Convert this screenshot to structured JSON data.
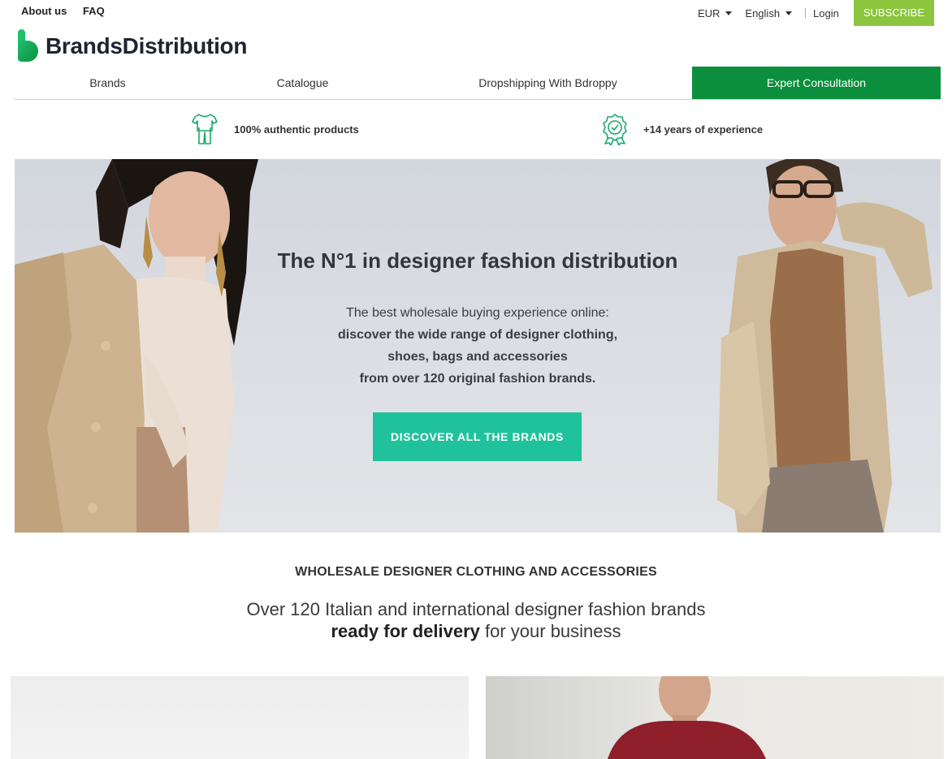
{
  "top_bar": {
    "links": [
      "About us",
      "FAQ"
    ],
    "currency": "EUR",
    "language": "English",
    "login": "Login",
    "subscribe": "SUBSCRIBE"
  },
  "logo": {
    "text": "BrandsDistribution"
  },
  "nav": {
    "items": [
      "Brands",
      "Catalogue",
      "Dropshipping With Bdroppy",
      "Expert Consultation"
    ]
  },
  "features": [
    {
      "icon": "clothing-icon",
      "text": "100% authentic products"
    },
    {
      "icon": "award-ribbon-icon",
      "text": "+14 years of experience"
    }
  ],
  "hero": {
    "title": "The N°1 in designer fashion distribution",
    "line1": "The best wholesale buying experience online:",
    "line2": "discover the wide range of designer clothing,",
    "line3": "shoes, bags and accessories",
    "line4": "from over 120 original fashion brands.",
    "button": "DISCOVER ALL THE BRANDS"
  },
  "section": {
    "title": "WHOLESALE DESIGNER CLOTHING AND ACCESSORIES",
    "sub_line1": "Over 120 Italian and international designer fashion brands",
    "sub_bold": "ready for delivery",
    "sub_rest": " for your business"
  },
  "colors": {
    "brand_green": "#0b8f3c",
    "subscribe_green": "#8cc63f",
    "cta_teal": "#1fc29b"
  }
}
